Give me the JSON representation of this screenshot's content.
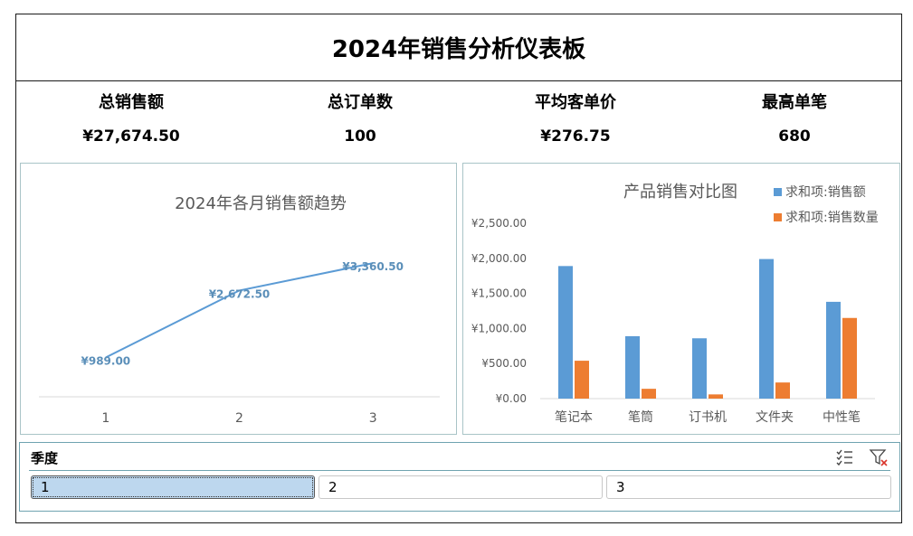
{
  "dashboard": {
    "title": "2024年销售分析仪表板"
  },
  "kpis": [
    {
      "label": "总销售额",
      "value": "¥27,674.50"
    },
    {
      "label": "总订单数",
      "value": "100"
    },
    {
      "label": "平均客单价",
      "value": "¥276.75"
    },
    {
      "label": "最高单笔",
      "value": "680"
    }
  ],
  "chart_data": [
    {
      "type": "line",
      "title": "2024年各月销售额趋势",
      "categories": [
        "1",
        "2",
        "3"
      ],
      "values": [
        989.0,
        2672.5,
        3360.5
      ],
      "data_labels": [
        "¥989.00",
        "¥2,672.50",
        "¥3,360.50"
      ],
      "ylim": [
        0,
        4500
      ],
      "color": "#5b9bd5",
      "grid": false,
      "legend": "none"
    },
    {
      "type": "bar",
      "title": "产品销售对比图",
      "categories": [
        "笔记本",
        "笔筒",
        "订书机",
        "文件夹",
        "中性笔"
      ],
      "series": [
        {
          "name": "求和项:销售额",
          "color": "#5b9bd5",
          "values": [
            1890,
            890,
            860,
            1990,
            1380
          ]
        },
        {
          "name": "求和项:销售数量",
          "color": "#ed7d31",
          "values": [
            540,
            140,
            60,
            230,
            1150
          ]
        }
      ],
      "yticks": [
        "¥0.00",
        "¥500.00",
        "¥1,000.00",
        "¥1,500.00",
        "¥2,000.00",
        "¥2,500.00"
      ],
      "ylim": [
        0,
        2500
      ],
      "grid": false,
      "legend": "top-right"
    }
  ],
  "slicer": {
    "title": "季度",
    "multi_select_icon": "multi-select-icon",
    "clear_filter_icon": "clear-filter-icon",
    "items": [
      {
        "label": "1",
        "selected": true
      },
      {
        "label": "2",
        "selected": false
      },
      {
        "label": "3",
        "selected": false
      }
    ]
  }
}
